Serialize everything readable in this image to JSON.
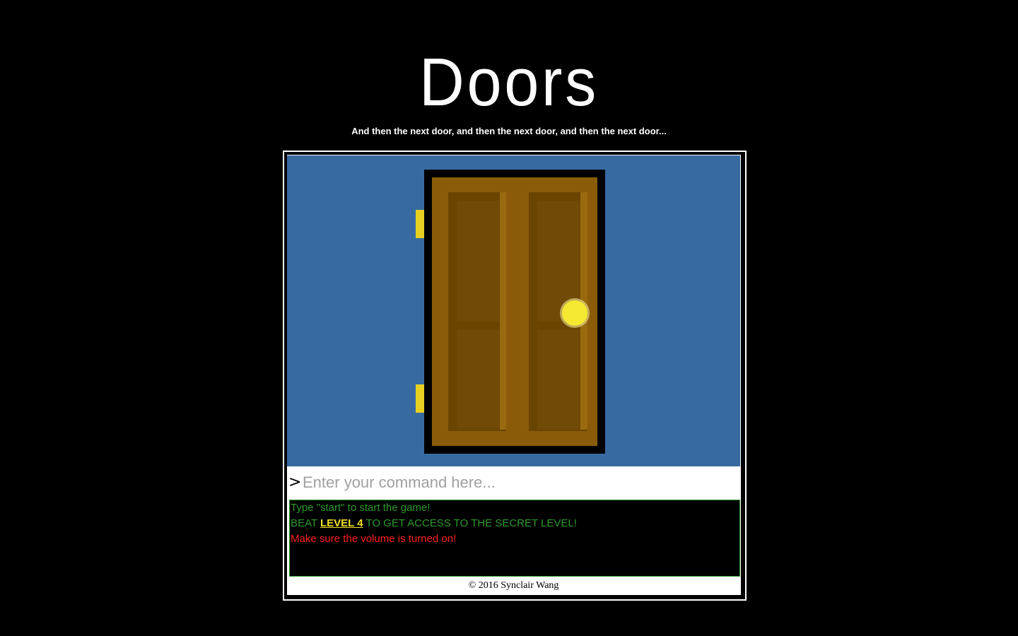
{
  "header": {
    "title": "Doors",
    "subtitle": "And then the next door, and then the next door, and then the next door..."
  },
  "scene": {
    "background_color": "#376aa1",
    "door_color": "#8a5c0a",
    "door_panel_color": "#6a4500",
    "frame_color": "#000000",
    "hinge_color": "#e8d020",
    "knob_color": "#f5e830",
    "icons": [
      "door-icon",
      "hinge-icon",
      "doorknob-icon"
    ]
  },
  "command": {
    "prompt_symbol": ">",
    "placeholder": "Enter your command here..."
  },
  "console": {
    "line1": "Type \"start\" to start the game!",
    "line2_prefix": "BEAT ",
    "line2_link": "LEVEL 4",
    "line2_suffix": " TO GET ACCESS TO THE SECRET LEVEL!",
    "line3": "Make sure the volume is turned on!",
    "colors": {
      "info": "#2e9a2e",
      "link": "#f0e020",
      "warning": "#ff2020"
    }
  },
  "footer": {
    "copyright": "© 2016 Synclair Wang"
  }
}
